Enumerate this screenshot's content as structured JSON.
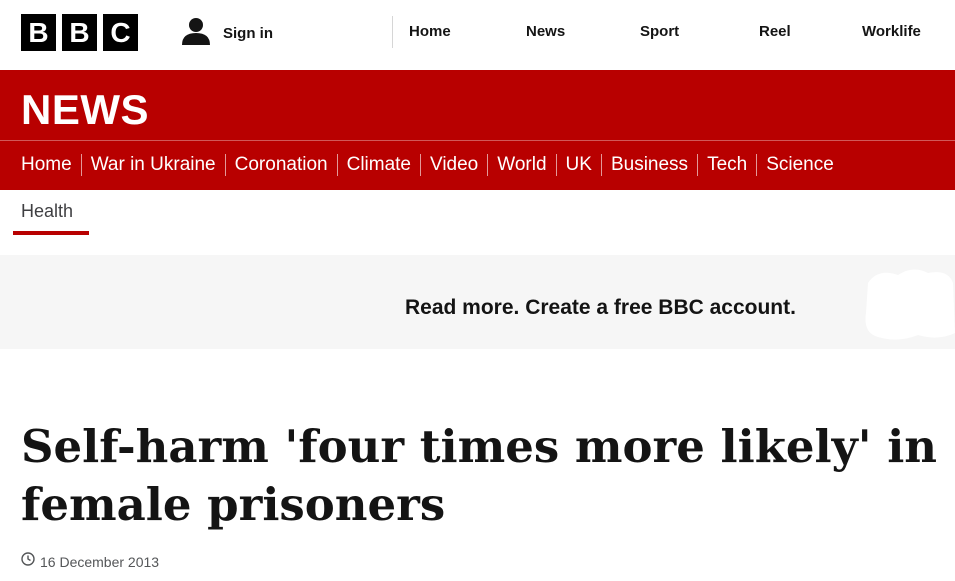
{
  "header": {
    "logo_letters": [
      "B",
      "B",
      "C"
    ],
    "sign_in": "Sign in",
    "nav": [
      {
        "label": "Home"
      },
      {
        "label": "News"
      },
      {
        "label": "Sport"
      },
      {
        "label": "Reel"
      },
      {
        "label": "Worklife"
      }
    ]
  },
  "news": {
    "title": "NEWS",
    "subnav": [
      {
        "label": "Home"
      },
      {
        "label": "War in Ukraine"
      },
      {
        "label": "Coronation"
      },
      {
        "label": "Climate"
      },
      {
        "label": "Video"
      },
      {
        "label": "World"
      },
      {
        "label": "UK"
      },
      {
        "label": "Business"
      },
      {
        "label": "Tech"
      },
      {
        "label": "Science"
      }
    ],
    "active_section": "Health"
  },
  "promo": {
    "text": "Read more. Create a free BBC account."
  },
  "article": {
    "headline": "Self-harm 'four times more likely' in female prisoners",
    "date": "16 December 2013"
  },
  "colors": {
    "brand_red": "#b80000",
    "promo_bg": "#f6f6f6",
    "text": "#141414"
  },
  "icons": {
    "user": "user-icon",
    "clock": "clock-icon"
  }
}
